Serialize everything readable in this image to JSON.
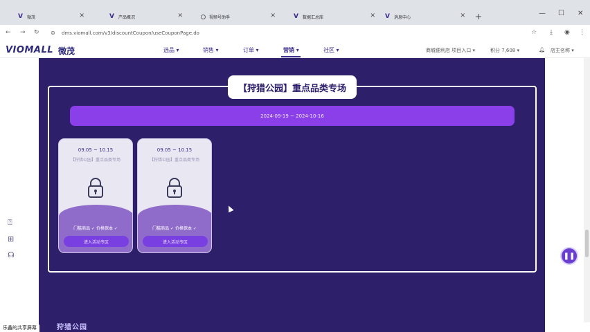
{
  "browser": {
    "tabs": [
      {
        "label": "微茂"
      },
      {
        "label": "产品概况"
      },
      {
        "label": "视频号助手"
      },
      {
        "label": "数据汇总库"
      },
      {
        "label": "消息中心"
      }
    ],
    "url": "dms.viomall.com/v3/discountCoupon/useCouponPage.do"
  },
  "site": {
    "logo": "VIOMALL",
    "logo_cn": "微茂",
    "nav": [
      "选品 ▾",
      "销售 ▾",
      "订单 ▾",
      "营销 ▾",
      "社区 ▾"
    ],
    "active_nav": "营销 ▾",
    "header_right": [
      "商城便利店 项目入口 ▾",
      "积分 7,608 ▾",
      "店主名称 ▾"
    ]
  },
  "section": {
    "title": "【狩猎公园】重点品类专场",
    "date_range": "2024-09-19 ~ 2024-10-16",
    "cards": [
      {
        "date": "09.05 ~ 10.15",
        "subtitle": "【狩猎公园】重点品类专场",
        "features": "门槛商品 ✓ 价格保本 ✓",
        "button": "进入活动专区"
      },
      {
        "date": "09.05 ~ 10.15",
        "subtitle": "【狩猎公园】重点品类专场",
        "features": "门槛商品 ✓ 价格保本 ✓",
        "button": "进入活动专区"
      }
    ],
    "bottom_title": "狩猎公园"
  },
  "status_text": "乐鑫的共享屏幕",
  "colors": {
    "page_bg": "#2e1f6b",
    "date_bar": "#8a3fe8",
    "card_wave": "#8f6cc9",
    "button": "#7a3fe0",
    "accent": "#3a2e8a"
  }
}
